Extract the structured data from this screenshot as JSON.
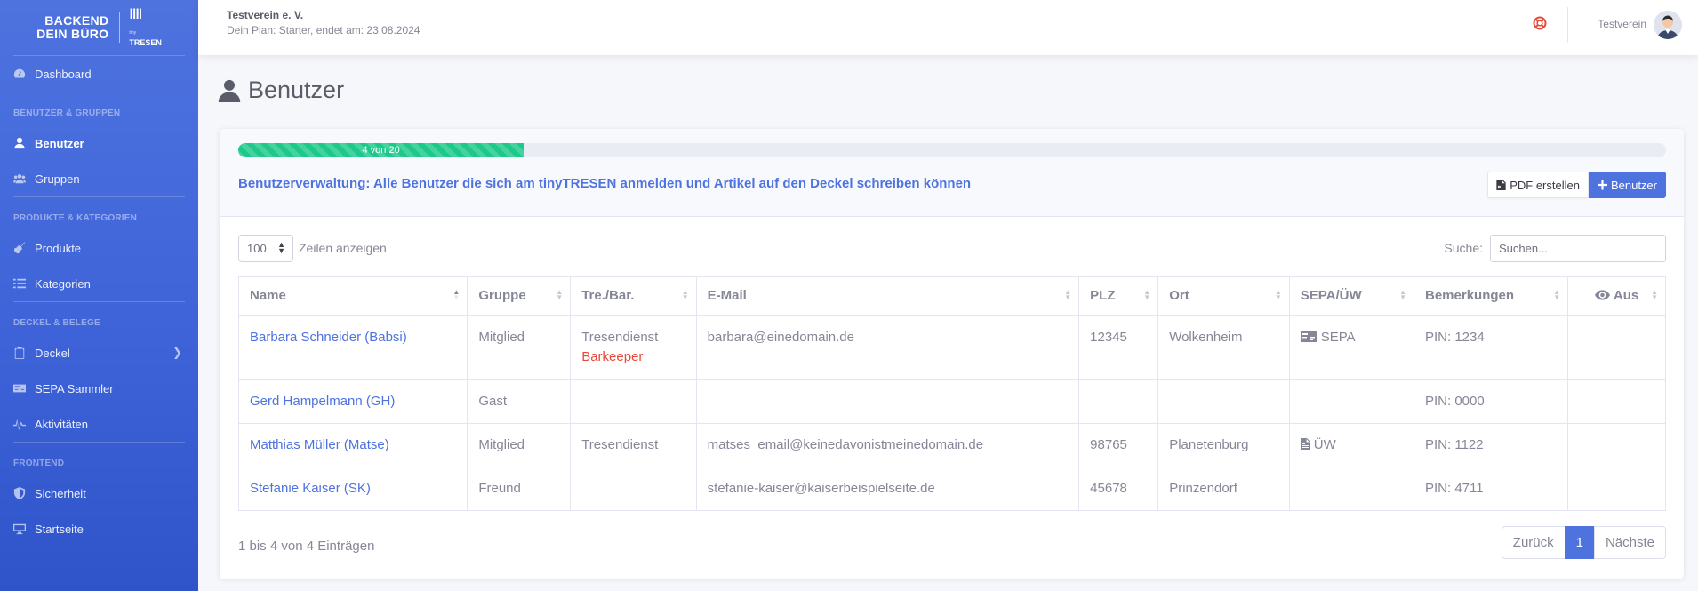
{
  "brand": {
    "line1": "BACKEND",
    "line2": "DEIN BÜRO",
    "logo_small": "tiny",
    "logo_name": "TRESEN"
  },
  "sidebar": {
    "dashboard": "Dashboard",
    "sections": [
      {
        "title": "BENUTZER & GRUPPEN",
        "items": [
          "Benutzer",
          "Gruppen"
        ]
      },
      {
        "title": "PRODUKTE & KATEGORIEN",
        "items": [
          "Produkte",
          "Kategorien"
        ]
      },
      {
        "title": "DECKEL & BELEGE",
        "items": [
          "Deckel",
          "SEPA Sammler",
          "Aktivitäten"
        ]
      },
      {
        "title": "FRONTEND",
        "items": [
          "Sicherheit",
          "Startseite"
        ]
      }
    ]
  },
  "topbar": {
    "org_name": "Testverein e. V.",
    "plan": "Dein Plan: Starter, endet am: 23.08.2024",
    "user": "Testverein"
  },
  "page": {
    "title": "Benutzer"
  },
  "card": {
    "progress_label": "4 von 20",
    "progress_fraction": 0.2,
    "description": "Benutzerverwaltung: Alle Benutzer die sich am tinyTRESEN anmelden und Artikel auf den Deckel schreiben können",
    "pdf_button": "PDF erstellen",
    "add_button": "Benutzer"
  },
  "table_controls": {
    "page_length": "100",
    "length_label": "Zeilen anzeigen",
    "search_label": "Suche:",
    "search_placeholder": "Suchen..."
  },
  "table": {
    "columns": [
      "Name",
      "Gruppe",
      "Tre./Bar.",
      "E-Mail",
      "PLZ",
      "Ort",
      "SEPA/ÜW",
      "Bemerkungen",
      "Aus"
    ],
    "rows": [
      {
        "name": "Barbara Schneider (Babsi)",
        "group": "Mitglied",
        "role": "Tresendienst",
        "role_extra": "Barkeeper",
        "email": "barbara@einedomain.de",
        "plz": "12345",
        "ort": "Wolkenheim",
        "payment": "SEPA",
        "note": "PIN: 1234"
      },
      {
        "name": "Gerd Hampelmann (GH)",
        "group": "Gast",
        "role": "",
        "email": "",
        "plz": "",
        "ort": "",
        "payment": "",
        "note": "PIN: 0000"
      },
      {
        "name": "Matthias Müller (Matse)",
        "group": "Mitglied",
        "role": "Tresendienst",
        "email": "matses_email@keinedavonistmeinedomain.de",
        "plz": "98765",
        "ort": "Planetenburg",
        "payment": "ÜW",
        "note": "PIN: 1122"
      },
      {
        "name": "Stefanie Kaiser (SK)",
        "group": "Freund",
        "role": "",
        "email": "stefanie-kaiser@kaiserbeispielseite.de",
        "plz": "45678",
        "ort": "Prinzendorf",
        "payment": "",
        "note": "PIN: 4711"
      }
    ]
  },
  "footer": {
    "info": "1 bis 4 von 4 Einträgen",
    "prev": "Zurück",
    "page": "1",
    "next": "Nächste"
  },
  "colors": {
    "primary": "#4e73df",
    "success": "#1cc88a",
    "danger": "#e74a3b"
  }
}
